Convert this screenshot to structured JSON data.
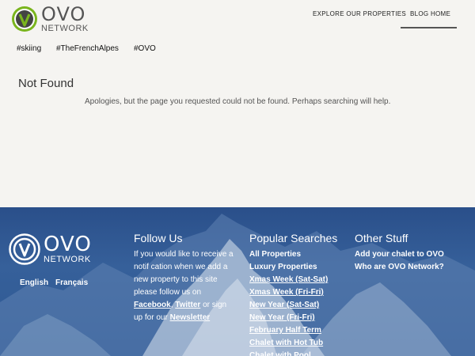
{
  "header": {
    "logo": {
      "big": "OVO",
      "small": "NETWORK"
    },
    "nav": [
      {
        "label": "EXPLORE OUR PROPERTIES"
      },
      {
        "label": "BLOG HOME"
      }
    ]
  },
  "tags": [
    "#skiing",
    "#TheFrenchAlpes",
    "#OVO"
  ],
  "not_found": {
    "title": "Not Found",
    "message": "Apologies, but the page you requested could not be found. Perhaps searching will help."
  },
  "footer": {
    "logo": {
      "big": "OVO",
      "small": "NETWORK"
    },
    "languages": [
      "English",
      "Français"
    ],
    "follow": {
      "title": "Follow Us",
      "text_before": "If you would like to receive a notif cation when we add a new property to this site please follow us on ",
      "facebook": "Facebook",
      "sep": ", ",
      "twitter": "Twitter",
      "text_mid": " or sign up for our ",
      "newsletter": "Newsletter"
    },
    "popular": {
      "title": "Popular Searches",
      "items": [
        "All Properties",
        "Luxury Properties",
        "Xmas Week (Sat-Sat)",
        "Xmas Week (Fri-Fri)",
        "New Year (Sat-Sat)",
        "New Year (Fri-Fri)",
        "February Half Term",
        "Chalet with Hot Tub",
        "Chalet with Pool"
      ]
    },
    "other": {
      "title": "Other Stuff",
      "items": [
        "Add your chalet to OVO",
        "Who are OVO Network?"
      ]
    }
  },
  "colors": {
    "brand_green": "#7ab51d",
    "footer_blue": "#2f5a94",
    "page_bg": "#f5f4f1"
  }
}
